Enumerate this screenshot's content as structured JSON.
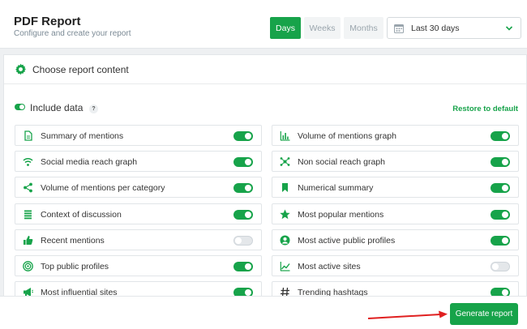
{
  "header": {
    "title": "PDF Report",
    "subtitle": "Configure and create your report",
    "periods": {
      "days": "Days",
      "weeks": "Weeks",
      "months": "Months"
    },
    "date_range": "Last 30 days"
  },
  "panel": {
    "title": "Choose report content",
    "include_label": "Include data",
    "help_mark": "?",
    "restore_label": "Restore to default"
  },
  "items": [
    {
      "label": "Summary of mentions",
      "icon": "document-icon",
      "on": true
    },
    {
      "label": "Volume of mentions graph",
      "icon": "bar-chart-icon",
      "on": true
    },
    {
      "label": "Social media reach graph",
      "icon": "wifi-icon",
      "on": true
    },
    {
      "label": "Non social reach graph",
      "icon": "network-icon",
      "on": true
    },
    {
      "label": "Volume of mentions per category",
      "icon": "share-icon",
      "on": true
    },
    {
      "label": "Numerical summary",
      "icon": "bookmark-icon",
      "on": true
    },
    {
      "label": "Context of discussion",
      "icon": "list-icon",
      "on": true
    },
    {
      "label": "Most popular mentions",
      "icon": "star-icon",
      "on": true
    },
    {
      "label": "Recent mentions",
      "icon": "thumbs-up-icon",
      "on": false
    },
    {
      "label": "Most active public profiles",
      "icon": "user-circle-icon",
      "on": true
    },
    {
      "label": "Top public profiles",
      "icon": "target-icon",
      "on": true
    },
    {
      "label": "Most active sites",
      "icon": "line-chart-icon",
      "on": false
    },
    {
      "label": "Most influential sites",
      "icon": "megaphone-icon",
      "on": true
    },
    {
      "label": "Trending hashtags",
      "icon": "hashtag-icon",
      "on": true
    }
  ],
  "footer": {
    "generate_label": "Generate report"
  },
  "colors": {
    "accent": "#17a34a",
    "arrow": "#e02020"
  }
}
